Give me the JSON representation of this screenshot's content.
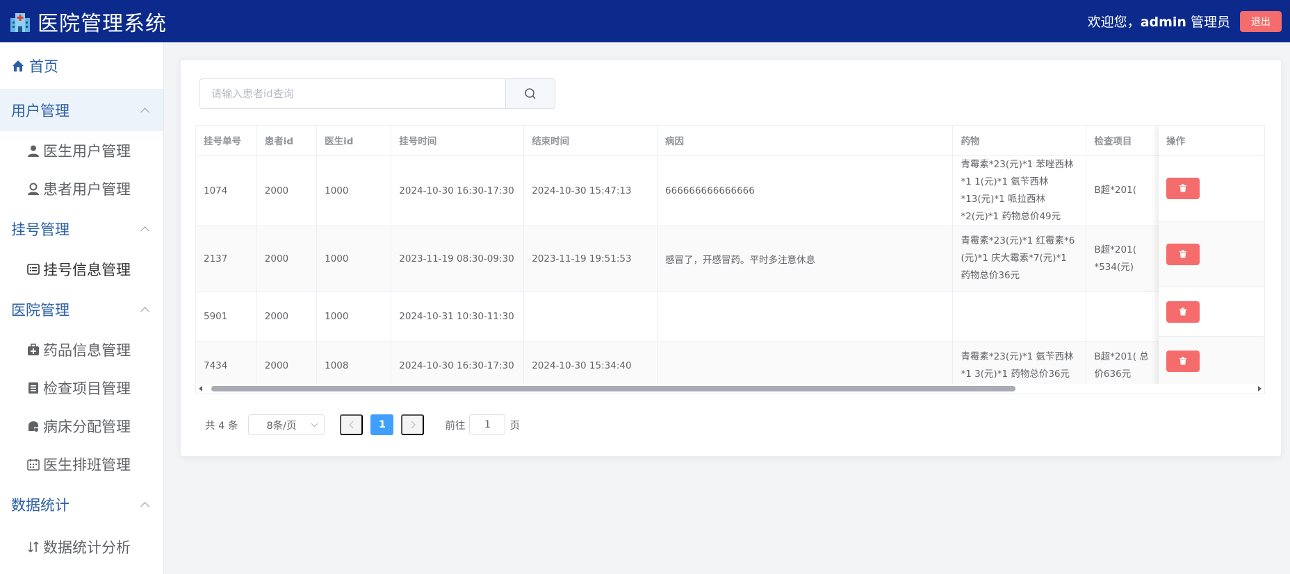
{
  "header": {
    "title": "医院管理系统",
    "welcome_prefix": "欢迎您，",
    "username": "admin",
    "role": " 管理员",
    "logout_label": "退出"
  },
  "sidebar": {
    "home": "首页",
    "groups": [
      {
        "title": "用户管理",
        "items": [
          "医生用户管理",
          "患者用户管理"
        ]
      },
      {
        "title": "挂号管理",
        "items": [
          "挂号信息管理"
        ]
      },
      {
        "title": "医院管理",
        "items": [
          "药品信息管理",
          "检查项目管理",
          "病床分配管理",
          "医生排班管理"
        ]
      },
      {
        "title": "数据统计",
        "items": [
          "数据统计分析"
        ]
      }
    ]
  },
  "search": {
    "placeholder": "请输入患者id查询"
  },
  "table": {
    "columns": [
      "挂号单号",
      "患者id",
      "医生id",
      "挂号时间",
      "结束时间",
      "病因",
      "药物",
      "检查项目",
      "操作"
    ],
    "rows": [
      {
        "id": "1074",
        "patient_id": "2000",
        "doctor_id": "1000",
        "reg_time": "2024-10-30 16:30-17:30",
        "end_time": "2024-10-30 15:47:13",
        "cause": "666666666666666",
        "drugs": "青霉素*23(元)*1 苯唑西林*1 1(元)*1 氨苄西林*13(元)*1 哌拉西林*2(元)*1 药物总价49元",
        "checks": "B超*201("
      },
      {
        "id": "2137",
        "patient_id": "2000",
        "doctor_id": "1000",
        "reg_time": "2023-11-19 08:30-09:30",
        "end_time": "2023-11-19 19:51:53",
        "cause": "感冒了，开感冒药。平时多注意休息",
        "drugs": "青霉素*23(元)*1 红霉素*6 (元)*1 庆大霉素*7(元)*1 药物总价36元",
        "checks": "B超*201( *534(元)"
      },
      {
        "id": "5901",
        "patient_id": "2000",
        "doctor_id": "1000",
        "reg_time": "2024-10-31 10:30-11:30",
        "end_time": "",
        "cause": "",
        "drugs": "",
        "checks": ""
      },
      {
        "id": "7434",
        "patient_id": "2000",
        "doctor_id": "1008",
        "reg_time": "2024-10-30 16:30-17:30",
        "end_time": "2024-10-30 15:34:40",
        "cause": "",
        "drugs": "青霉素*23(元)*1 氨苄西林*1 3(元)*1 药物总价36元",
        "checks": "B超*201( 总价636元"
      }
    ]
  },
  "pagination": {
    "total_label": "共 4 条",
    "page_size": "8条/页",
    "current_page": "1",
    "goto_label": "前往",
    "goto_value": "1",
    "page_suffix": "页"
  },
  "colors": {
    "header_bg": "#0b2a8c",
    "accent": "#409eff",
    "danger": "#f56c6c",
    "menu_group": "#2b5fa6"
  }
}
